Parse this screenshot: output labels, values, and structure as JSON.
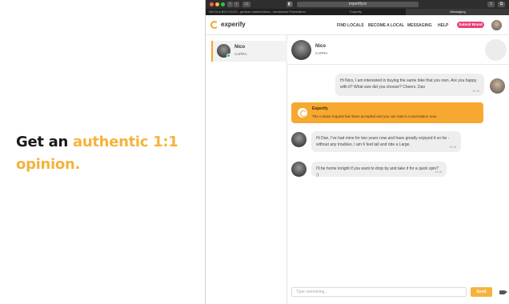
{
  "headline": {
    "part1": "Get an ",
    "accent": "authentic 1:1",
    "part2": "opinion."
  },
  "browser": {
    "url": "experify.io",
    "tabs": [
      "NICOLA BICYCLES - german crafted bikes - handmade Probefahren",
      "Experify",
      "Messaging"
    ]
  },
  "nav": {
    "logo": "experify",
    "links": [
      "FIND LOCALS",
      "BECOME A LOCAL",
      "MESSAGING",
      "HELP"
    ],
    "submit": "Submit Brand"
  },
  "sidebar": {
    "contact_name": "Nico",
    "contact_sub": "CAPRA"
  },
  "chat": {
    "name": "Nico",
    "sub": "CAPRA",
    "messages": [
      {
        "text": "Hi Nico, I am interested in buying the same bike that you own. Are you happy with it? What size did you choose? Cheers, Dan",
        "time": "13:15"
      },
      {
        "text": "Hi Dan, I've had mine for two years now and have greatly enjoyed it so far - without any troubles. I am 6 feet tall and ride a Large.",
        "time": "13:16"
      },
      {
        "text": "I'll be home tonight if you want to drop by and take it for a quick spin? :)",
        "time": "13:16"
      }
    ],
    "system": {
      "title": "Experify",
      "text": "The contact request has been accepted and you can start a conversation now."
    },
    "input_placeholder": "Type something...",
    "send": "Send"
  },
  "colors": {
    "accent": "#f5b33d",
    "system_bg": "#f7a831",
    "submit_pink": "#e8407c"
  },
  "icons": [
    "logo-icon",
    "video-call-icon",
    "online-status-icon"
  ]
}
